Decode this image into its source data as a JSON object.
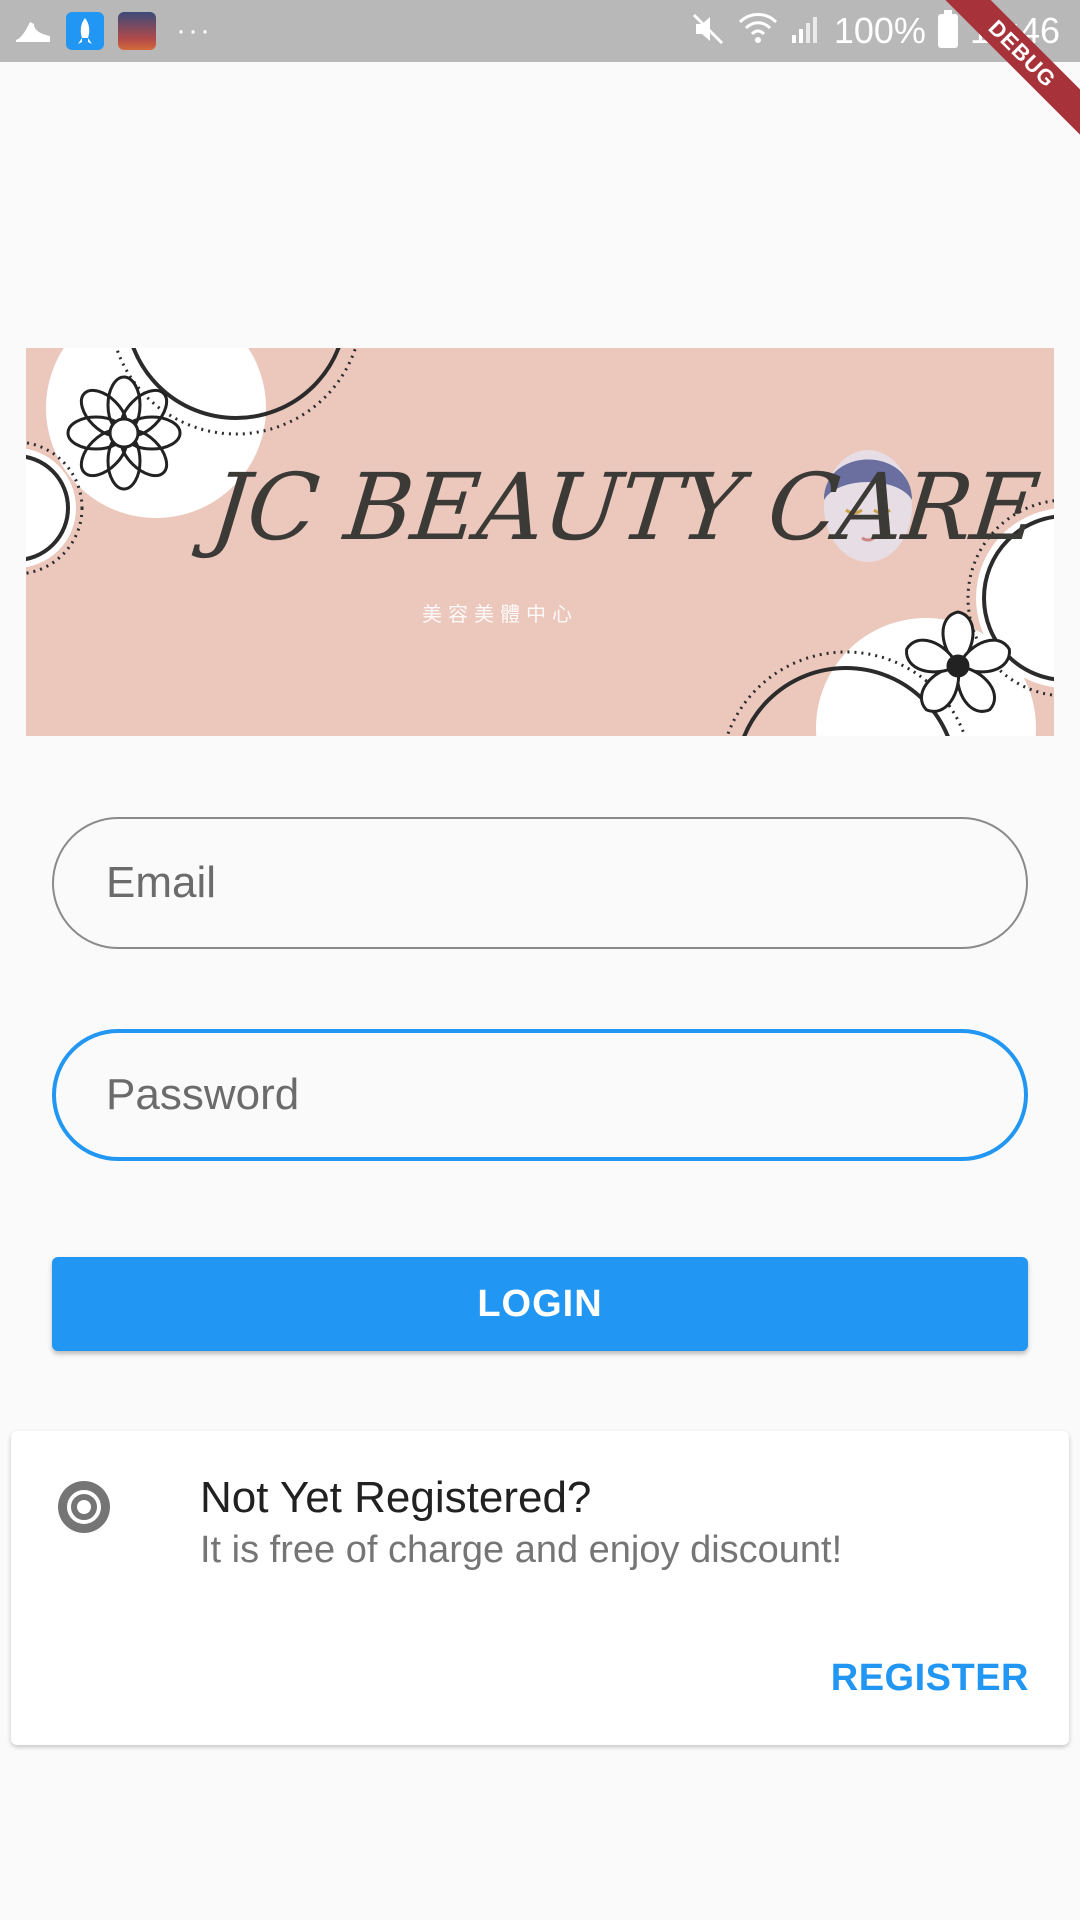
{
  "status_bar": {
    "battery_text": "100%",
    "time": "15:46",
    "overflow_dots": "···"
  },
  "debug_banner": {
    "label": "DEBUG"
  },
  "banner": {
    "title": "JC BEAUTY CARE",
    "subtitle": "美容美體中心"
  },
  "login_form": {
    "email_placeholder": "Email",
    "password_placeholder": "Password",
    "login_label": "LOGIN"
  },
  "register_card": {
    "title": "Not Yet Registered?",
    "subtitle": "It is free of charge and enjoy discount!",
    "register_label": "REGISTER"
  },
  "colors": {
    "accent": "#2196f3",
    "status_bar": "#b8b8b8",
    "banner_bg": "#ebc7bc",
    "debug": "#a8323a"
  }
}
